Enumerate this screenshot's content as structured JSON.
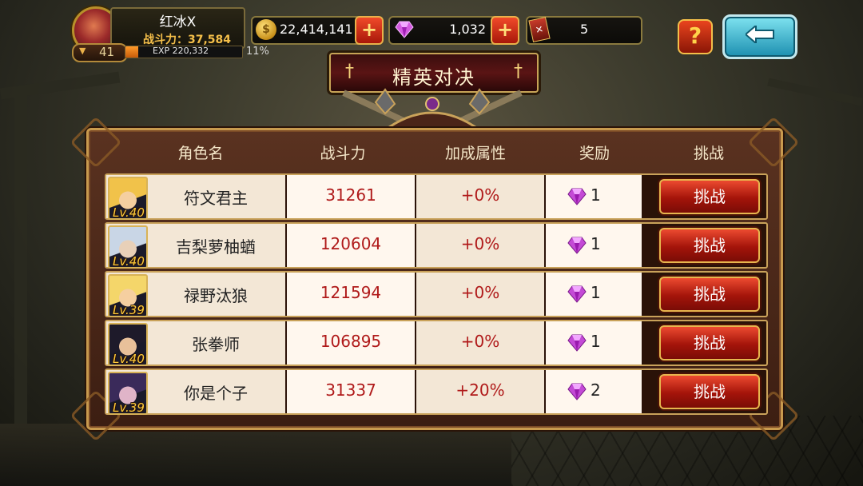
{
  "player": {
    "name": "红冰X",
    "power_label": "战斗力：37,584",
    "level": "41",
    "exp_label": "EXP 220,332",
    "exp_percent_text": "11%",
    "exp_fraction": 0.11
  },
  "resources": {
    "gold": "22,414,141",
    "gems": "1,032",
    "tickets": "5"
  },
  "title": "精英对决",
  "table": {
    "headers": [
      "角色名",
      "战斗力",
      "加成属性",
      "奖励",
      "挑战"
    ],
    "rows": [
      {
        "level": "Lv.40",
        "name": "符文君主",
        "power": "31261",
        "bonus": "+0%",
        "reward": "1",
        "action": "挑战",
        "hair": "#f1c24a",
        "skin": "#f5cfa0"
      },
      {
        "level": "Lv.40",
        "name": "吉梨萝柚蝤",
        "power": "120604",
        "bonus": "+0%",
        "reward": "1",
        "action": "挑战",
        "hair": "#c9d6e6",
        "skin": "#e8d0b8"
      },
      {
        "level": "Lv.39",
        "name": "禄野汰狼",
        "power": "121594",
        "bonus": "+0%",
        "reward": "1",
        "action": "挑战",
        "hair": "#f4d66a",
        "skin": "#f5cfa0"
      },
      {
        "level": "Lv.40",
        "name": "张拳师",
        "power": "106895",
        "bonus": "+0%",
        "reward": "1",
        "action": "挑战",
        "hair": "#1e1a2a",
        "skin": "#e8c09a"
      },
      {
        "level": "Lv.39",
        "name": "你是个子",
        "power": "31337",
        "bonus": "+20%",
        "reward": "2",
        "action": "挑战",
        "hair": "#3a2a5a",
        "skin": "#e0b4c8"
      }
    ]
  },
  "icons": {
    "gold": "coin-icon",
    "gem": "gem-icon",
    "ticket": "ticket-icon",
    "help": "?",
    "back": "back-arrow-icon"
  }
}
